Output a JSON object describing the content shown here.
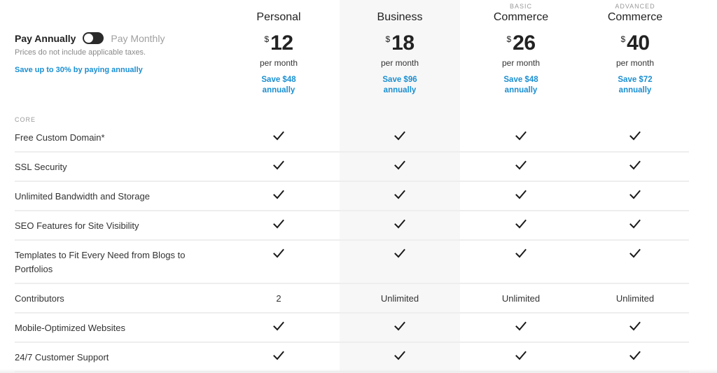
{
  "billing": {
    "annual_label": "Pay Annually",
    "monthly_label": "Pay Monthly",
    "toggle_state": "annual",
    "tax_note": "Prices do not include applicable taxes.",
    "save_note": "Save up to 30% by paying annually"
  },
  "colors": {
    "accent": "#1a8fd1",
    "highlight_column": "#f7f7f7",
    "toggle": "#2b2b2b"
  },
  "plans": [
    {
      "tier": "",
      "name": "Personal",
      "currency": "$",
      "amount": "12",
      "period": "per month",
      "save_line1": "Save $48",
      "save_line2": "annually"
    },
    {
      "tier": "",
      "name": "Business",
      "currency": "$",
      "amount": "18",
      "period": "per month",
      "save_line1": "Save $96",
      "save_line2": "annually"
    },
    {
      "tier": "BASIC",
      "name": "Commerce",
      "currency": "$",
      "amount": "26",
      "period": "per month",
      "save_line1": "Save $48",
      "save_line2": "annually"
    },
    {
      "tier": "ADVANCED",
      "name": "Commerce",
      "currency": "$",
      "amount": "40",
      "period": "per month",
      "save_line1": "Save $72",
      "save_line2": "annually"
    }
  ],
  "section": {
    "label": "CORE"
  },
  "features": [
    {
      "label": "Free Custom Domain*",
      "values": [
        "check",
        "check",
        "check",
        "check"
      ]
    },
    {
      "label": "SSL Security",
      "values": [
        "check",
        "check",
        "check",
        "check"
      ]
    },
    {
      "label": "Unlimited Bandwidth and Storage",
      "values": [
        "check",
        "check",
        "check",
        "check"
      ]
    },
    {
      "label": "SEO Features for Site Visibility",
      "values": [
        "check",
        "check",
        "check",
        "check"
      ]
    },
    {
      "label": "Templates to Fit Every Need from Blogs to Portfolios",
      "values": [
        "check",
        "check",
        "check",
        "check"
      ]
    },
    {
      "label": "Contributors",
      "values": [
        "2",
        "Unlimited",
        "Unlimited",
        "Unlimited"
      ]
    },
    {
      "label": "Mobile-Optimized Websites",
      "values": [
        "check",
        "check",
        "check",
        "check"
      ]
    },
    {
      "label": "24/7 Customer Support",
      "values": [
        "check",
        "check",
        "check",
        "check"
      ]
    }
  ]
}
